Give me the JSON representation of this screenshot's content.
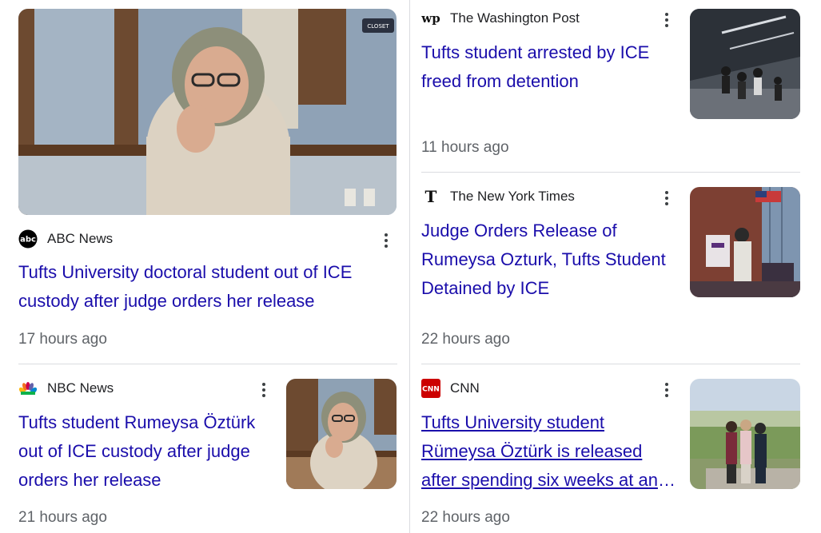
{
  "articles": [
    {
      "source": "ABC News",
      "logo": "abc-logo-icon",
      "headline": "Tufts University doctoral student out of ICE custody after judge orders her release",
      "time": "17 hours ago",
      "image_badge": "CLOSET"
    },
    {
      "source": "The Washington Post",
      "logo": "wp-logo-icon",
      "headline": "Tufts student arrested by ICE freed from detention",
      "time": "11 hours ago"
    },
    {
      "source": "The New York Times",
      "logo": "nyt-logo-icon",
      "headline": "Judge Orders Release of Rumeysa Ozturk, Tufts Student Detained by ICE",
      "time": "22 hours ago"
    },
    {
      "source": "NBC News",
      "logo": "nbc-peacock-icon",
      "headline": "Tufts student Rumeysa Öztürk out of ICE custody after judge orders her release",
      "time": "21 hours ago"
    },
    {
      "source": "CNN",
      "logo": "cnn-logo-icon",
      "headline": "Tufts University student Rümeysa Öztürk is released after spending six weeks at an ICE facility",
      "time": "22 hours ago"
    }
  ],
  "colors": {
    "headline": "#1a0dab",
    "meta": "#5f6368",
    "divider": "#dadce0",
    "cnn_red": "#cc0000"
  }
}
